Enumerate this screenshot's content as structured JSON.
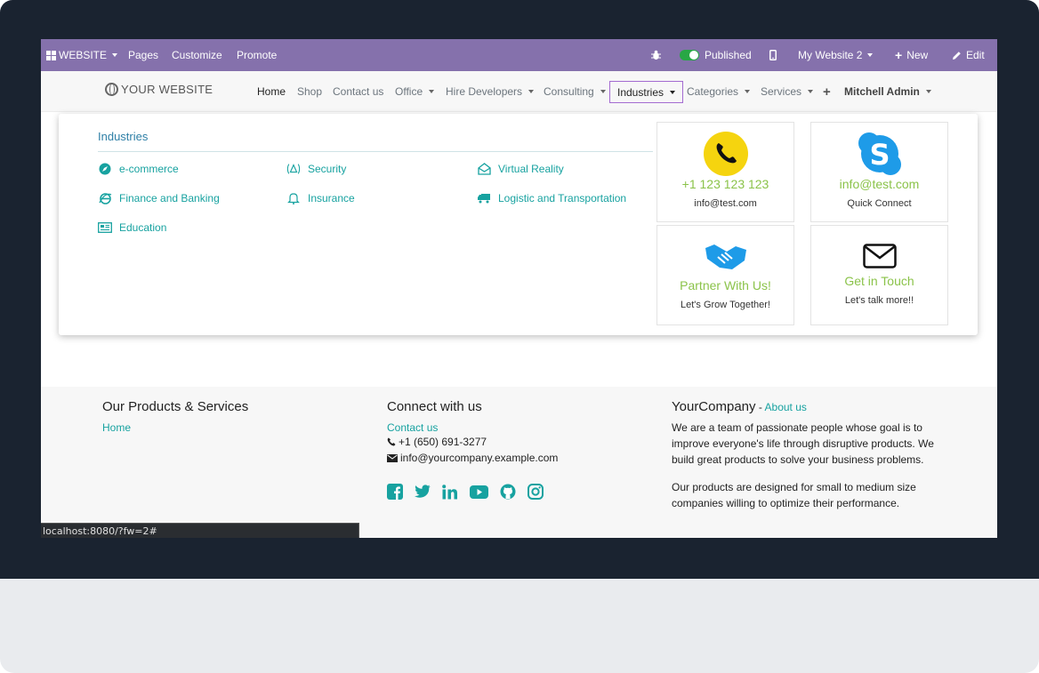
{
  "admin_bar": {
    "website_menu": "WEBSITE",
    "pages": "Pages",
    "customize": "Customize",
    "promote": "Promote",
    "published": "Published",
    "website_selector": "My Website 2",
    "new": "New",
    "edit": "Edit"
  },
  "site_nav": {
    "logo": "YOUR WEBSITE",
    "links": [
      "Home",
      "Shop",
      "Contact us",
      "Office",
      "Hire Developers",
      "Consulting",
      "Industries",
      "Categories",
      "Services"
    ],
    "user": "Mitchell Admin"
  },
  "mega_menu": {
    "title": "Industries",
    "items": [
      "e-commerce",
      "Security",
      "Virtual Reality",
      "Finance and Banking",
      "Insurance",
      "Logistic and Transportation",
      "Education"
    ],
    "cards": [
      {
        "big": "+1 123 123 123",
        "small": "info@test.com",
        "icon": "phone-icon",
        "color": "#f5d40f"
      },
      {
        "big": "info@test.com",
        "small": "Quick Connect",
        "icon": "skype-icon",
        "color": "#1e9be8"
      },
      {
        "big": "Partner With Us!",
        "small": "Let's Grow Together!",
        "icon": "handshake-icon",
        "color": "#1e9be8"
      },
      {
        "big": "Get in Touch",
        "small": "Let's talk more!!",
        "icon": "envelope-icon",
        "color": "#111111"
      }
    ]
  },
  "footer": {
    "col1": {
      "title": "Our Products & Services",
      "links": [
        "Home"
      ]
    },
    "col2": {
      "title": "Connect with us",
      "contact": "Contact us",
      "phone": "+1 (650) 691-3277",
      "email": "info@yourcompany.example.com"
    },
    "col3": {
      "title": "YourCompany",
      "sep": " - ",
      "about": "About us",
      "p1": "We are a team of passionate people whose goal is to improve everyone's life through disruptive products. We build great products to solve your business problems.",
      "p2": "Our products are designed for small to medium size companies willing to optimize their performance."
    }
  },
  "status_url": "localhost:8080/?fw=2#",
  "colors": {
    "admin_bar": "#8571ac",
    "accent": "#17a2a0",
    "card_text": "#8bc34a",
    "active_border": "#a36bd1"
  }
}
